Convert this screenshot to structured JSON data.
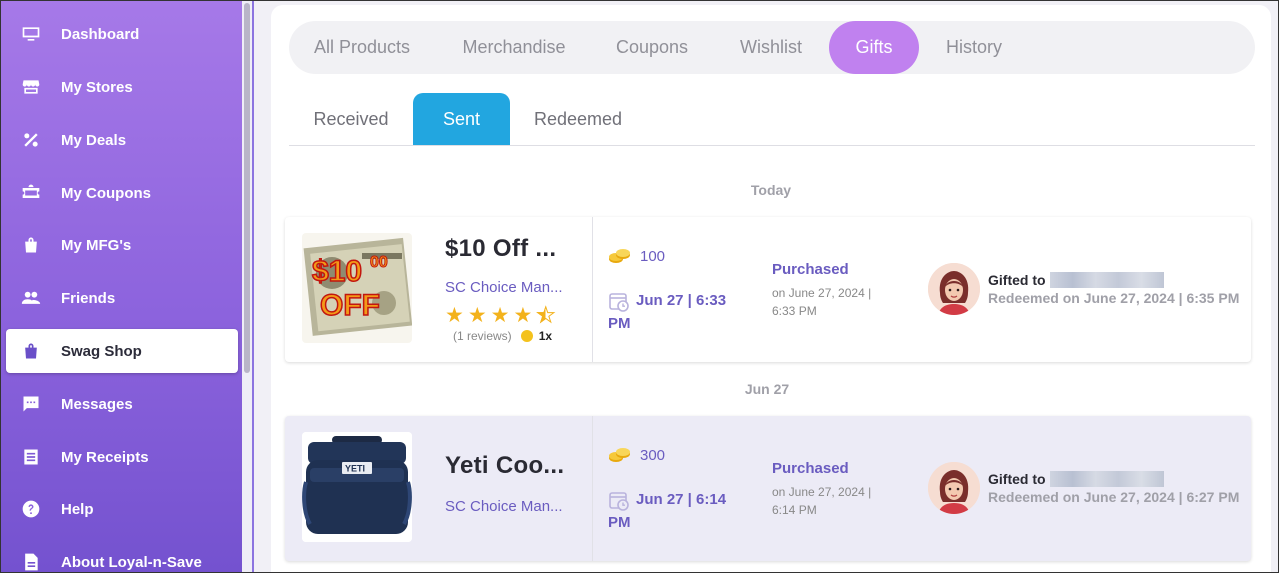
{
  "sidebar": {
    "items": [
      {
        "label": "Dashboard",
        "icon": "monitor-icon"
      },
      {
        "label": "My Stores",
        "icon": "store-icon"
      },
      {
        "label": "My Deals",
        "icon": "percent-icon"
      },
      {
        "label": "My Coupons",
        "icon": "coupon-icon"
      },
      {
        "label": "My MFG's",
        "icon": "bag-icon"
      },
      {
        "label": "Friends",
        "icon": "people-icon"
      },
      {
        "label": "Swag Shop",
        "icon": "shopping-bag-icon",
        "active": true
      },
      {
        "label": "Messages",
        "icon": "message-icon"
      },
      {
        "label": "My Receipts",
        "icon": "receipt-icon"
      },
      {
        "label": "Help",
        "icon": "help-icon"
      },
      {
        "label": "About Loyal-n-Save",
        "icon": "document-icon"
      }
    ]
  },
  "tabs": [
    "All Products",
    "Merchandise",
    "Coupons",
    "Wishlist",
    "Gifts",
    "History"
  ],
  "active_tab": "Gifts",
  "subtabs": [
    "Received",
    "Sent",
    "Redeemed"
  ],
  "active_subtab": "Sent",
  "groups": [
    {
      "date": "Today",
      "item": {
        "title": "$10 Off ...",
        "subtitle": "SC Choice Man...",
        "rating": 4.5,
        "reviews": "(1 reviews)",
        "multiplier": "1x",
        "coins": "100",
        "date_line1": "Jun 27 | 6:33",
        "date_line2": "PM",
        "status": "Purchased",
        "status_sub": "on June 27, 2024 | 6:33 PM",
        "gifted_label": "Gifted to",
        "redeemed": "Redeemed on June 27, 2024 | 6:35 PM",
        "thumb_text_top": "$10",
        "thumb_text_sup": "00",
        "thumb_text_bottom": "OFF"
      }
    },
    {
      "date": "Jun 27",
      "item": {
        "title": "Yeti Coo...",
        "subtitle": "SC Choice Man...",
        "coins": "300",
        "date_line1": "Jun 27 | 6:14",
        "date_line2": "PM",
        "status": "Purchased",
        "status_sub": "on June 27, 2024 | 6:14 PM",
        "gifted_label": "Gifted to",
        "redeemed": "Redeemed on June 27, 2024 | 6:27 PM",
        "thumb_text": "YETI"
      }
    }
  ],
  "colors": {
    "sidebar_top": "#a679e8",
    "sidebar_bottom": "#7452cf",
    "active_tab": "#c081ef",
    "active_subtab": "#22a6e0",
    "accent_text": "#6a5cc0",
    "star": "#f3b21c"
  }
}
